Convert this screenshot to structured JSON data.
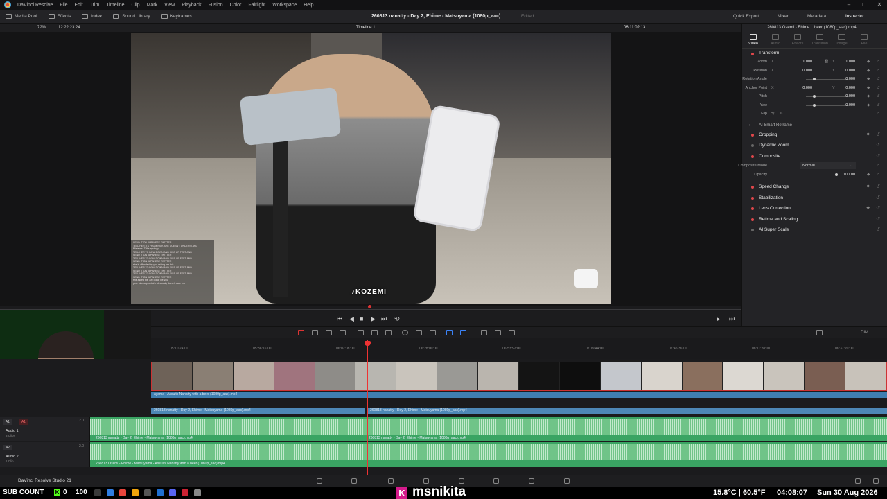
{
  "menubar": {
    "app_name": "DaVinci Resolve",
    "items": [
      "File",
      "Edit",
      "Trim",
      "Timeline",
      "Clip",
      "Mark",
      "View",
      "Playback",
      "Fusion",
      "Color",
      "Fairlight",
      "Workspace",
      "Help"
    ]
  },
  "toolbar": {
    "media_pool": "Media Pool",
    "effects": "Effects",
    "index": "Index",
    "sound_library": "Sound Library",
    "keyframes": "Keyframes",
    "project_title": "260813  nanatty - Day 2, Ehime - Matsuyama (1080p_aac)",
    "edited": "Edited",
    "quick_export": "Quick Export",
    "mixer": "Mixer",
    "metadata": "Metadata",
    "inspector": "Inspector"
  },
  "viewer": {
    "zoom": "72%",
    "source_timecode": "12:22:23:24",
    "timeline_name": "Timeline 1",
    "record_timecode": "06:11:02:13",
    "watermark": "♪KOZEMI",
    "chat_lines": [
      "SEND IT ON JAPANESE TWITTER",
      "TELL HER ITS FROM NICK SHE DOESN'T UNDERSTAND",
      "Mistakes: Talks apology",
      "TELL HER TO BOW DOWN AND KISS UR FEET AND",
      "SEND IT ON JAPANESE TWITTER",
      "TELL HER TO BOW DOWN AND KISS UR FEET AND",
      "SEND IT ON JAPANESE TWITTER",
      "she is offended by you asking her this",
      "TELL HER TO BOW DOWN AND KISS UR FEET AND",
      "SEND IT ON JAPANESE TWITTER",
      "TELL HER TO BOW DOWN AND KISS UR FEET AND",
      "SEND IT ON JAPANESE TWITTER",
      "she asked the 700 dollar ice you",
      "your nice support she obviously doesn't care bro"
    ]
  },
  "inspector": {
    "clip_name": "260813 Ozemi - Ehime... beer (1080p_aac).mp4",
    "tabs": [
      "Video",
      "Audio",
      "Effects",
      "Transition",
      "Image",
      "File"
    ],
    "sections": {
      "transform": "Transform",
      "smart_reframe": "AI Smart Reframe",
      "cropping": "Cropping",
      "dynamic_zoom": "Dynamic Zoom",
      "composite": "Composite",
      "speed_change": "Speed Change",
      "stabilization": "Stabilization",
      "lens_correction": "Lens Correction",
      "retime_scaling": "Retime and Scaling",
      "super_scale": "AI Super Scale"
    },
    "transform": {
      "zoom_label": "Zoom",
      "zoom_x": "1.000",
      "zoom_y": "1.000",
      "position_label": "Position",
      "position_x": "0.000",
      "position_y": "0.000",
      "rotation_label": "Rotation Angle",
      "rotation": "0.000",
      "anchor_label": "Anchor Point",
      "anchor_x": "0.000",
      "anchor_y": "0.000",
      "pitch_label": "Pitch",
      "pitch": "0.000",
      "yaw_label": "Yaw",
      "yaw": "0.000",
      "flip_label": "Flip",
      "x": "X",
      "y": "Y"
    },
    "composite": {
      "mode_label": "Composite Mode",
      "mode": "Normal",
      "opacity_label": "Opacity",
      "opacity": "100.00"
    }
  },
  "timeline": {
    "ruler_ticks": [
      "05:10:24:00",
      "05:36:16:00",
      "06:02:08:00",
      "06:28:00:00",
      "06:53:52:00",
      "07:19:44:00",
      "07:45:36:00",
      "08:11:28:00",
      "08:37:20:00"
    ],
    "video_clip_1": "ayama - Assults Nanatty with a beer (1080p_aac).mp4",
    "video_clip_2a": "260813  nanatty - Day 2, Ehime - Matsuyama (1080p_aac).mp4",
    "video_clip_2b": "260813  nanatty - Day 2, Ehime - Matsuyama (1080p_aac).mp4",
    "audio1": {
      "badge": "A1",
      "name": "Audio 1",
      "clips": "3 Clips",
      "level": "2.0",
      "clip_a": "260813  nanatty - Day 2, Ehime - Matsuyama (1080p_aac).mp4",
      "clip_b": "260813  nanatty - Day 2, Ehime - Matsuyama (1080p_aac).mp4"
    },
    "audio2": {
      "badge": "A2",
      "name": "Audio 2",
      "clips": "1 Clip",
      "level": "2.0",
      "clip_a": "260813  Ozemi - Ehime - Matsuyama - Assults Nanatty with a beer (1080p_aac).mp4"
    },
    "dim": "DIM"
  },
  "pagebar": {
    "resolve_name": "DaVinci Resolve Studio 21"
  },
  "taskbar": {
    "sub_count_label": "SUB COUNT",
    "kick_letter": "K",
    "sub_count": "0",
    "sub_goal": "100",
    "stream_letter": "K",
    "stream_name": "msnikita",
    "temperature": "15.8°C | 60.5°F",
    "time": "04:08:07",
    "date": "Sun 30 Aug 2026"
  }
}
